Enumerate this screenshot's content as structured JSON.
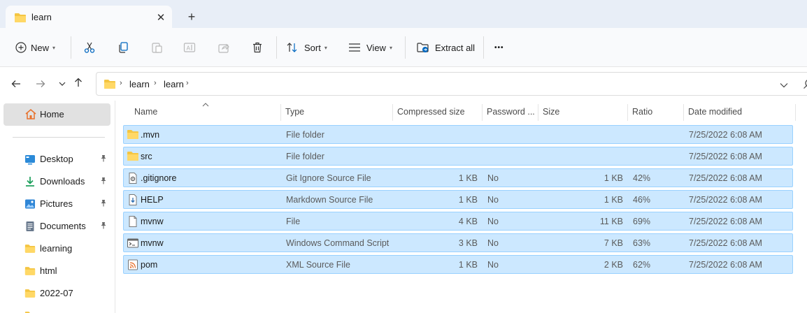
{
  "window": {
    "tab_title": "learn",
    "tab_close": "✕",
    "tab_add": "+"
  },
  "toolbar": {
    "new_label": "New",
    "sort_label": "Sort",
    "view_label": "View",
    "extract_label": "Extract all",
    "more_label": "•••",
    "icons": [
      "plus-circle-icon",
      "cut-icon",
      "copy-icon",
      "paste-icon",
      "rename-icon",
      "share-icon",
      "delete-icon",
      "sort-icon",
      "view-icon",
      "extract-icon",
      "more-icon"
    ]
  },
  "address": {
    "crumbs": [
      "learn",
      "learn"
    ]
  },
  "sidebar": {
    "home_label": "Home",
    "items": [
      {
        "label": "Desktop",
        "icon": "desktop-icon",
        "pinned": true
      },
      {
        "label": "Downloads",
        "icon": "downloads-icon",
        "pinned": true
      },
      {
        "label": "Pictures",
        "icon": "pictures-icon",
        "pinned": true
      },
      {
        "label": "Documents",
        "icon": "documents-icon",
        "pinned": true
      },
      {
        "label": "learning",
        "icon": "folder-icon",
        "pinned": false
      },
      {
        "label": "html",
        "icon": "folder-icon",
        "pinned": false
      },
      {
        "label": "2022-07",
        "icon": "folder-icon",
        "pinned": false
      }
    ]
  },
  "columns": {
    "name": "Name",
    "type": "Type",
    "compressed": "Compressed size",
    "password": "Password ...",
    "size": "Size",
    "ratio": "Ratio",
    "date": "Date modified"
  },
  "files": [
    {
      "name": ".mvn",
      "type": "File folder",
      "compressed": "",
      "password": "",
      "size": "",
      "ratio": "",
      "date": "7/25/2022 6:08 AM",
      "icon": "folder-icon"
    },
    {
      "name": "src",
      "type": "File folder",
      "compressed": "",
      "password": "",
      "size": "",
      "ratio": "",
      "date": "7/25/2022 6:08 AM",
      "icon": "folder-icon"
    },
    {
      "name": ".gitignore",
      "type": "Git Ignore Source File",
      "compressed": "1 KB",
      "password": "No",
      "size": "1 KB",
      "ratio": "42%",
      "date": "7/25/2022 6:08 AM",
      "icon": "settings-file-icon"
    },
    {
      "name": "HELP",
      "type": "Markdown Source File",
      "compressed": "1 KB",
      "password": "No",
      "size": "1 KB",
      "ratio": "46%",
      "date": "7/25/2022 6:08 AM",
      "icon": "markdown-file-icon"
    },
    {
      "name": "mvnw",
      "type": "File",
      "compressed": "4 KB",
      "password": "No",
      "size": "11 KB",
      "ratio": "69%",
      "date": "7/25/2022 6:08 AM",
      "icon": "blank-file-icon"
    },
    {
      "name": "mvnw",
      "type": "Windows Command Script",
      "compressed": "3 KB",
      "password": "No",
      "size": "7 KB",
      "ratio": "63%",
      "date": "7/25/2022 6:08 AM",
      "icon": "script-file-icon"
    },
    {
      "name": "pom",
      "type": "XML Source File",
      "compressed": "1 KB",
      "password": "No",
      "size": "2 KB",
      "ratio": "62%",
      "date": "7/25/2022 6:08 AM",
      "icon": "xml-file-icon"
    }
  ],
  "colors": {
    "accent": "#0067c0",
    "selection": "#cce8ff",
    "selection_border": "#99d1ff",
    "folder": "#f4c542"
  }
}
